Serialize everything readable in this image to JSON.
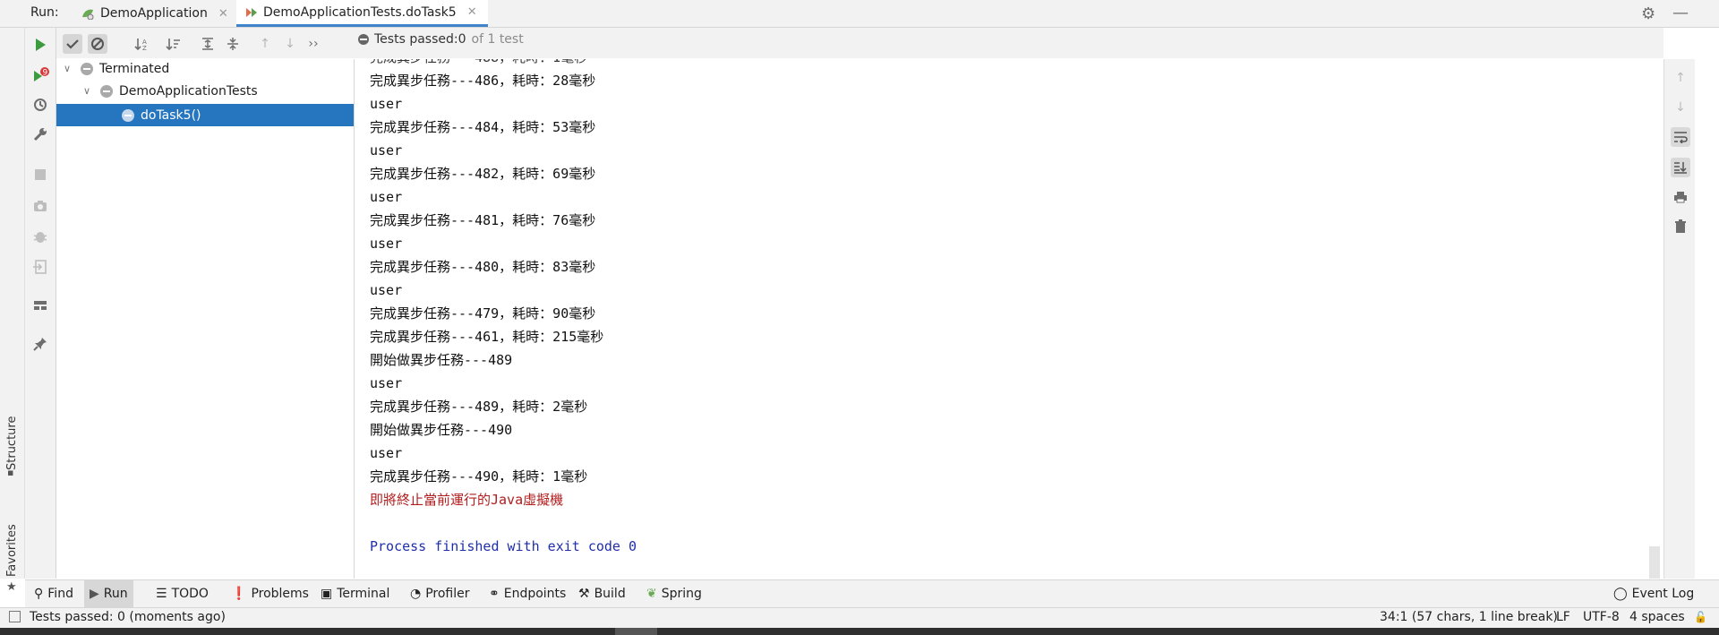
{
  "run_bar": {
    "label": "Run:",
    "tabs": [
      {
        "label": "DemoApplication",
        "active": false
      },
      {
        "label": "DemoApplicationTests.doTask5",
        "active": true
      }
    ]
  },
  "side_strip": {
    "structure_label": "Structure",
    "favorites_label": "Favorites"
  },
  "test_status": {
    "prefix": "Tests passed: ",
    "passed": "0",
    "suffix": "of 1 test"
  },
  "tree": {
    "root": "Terminated",
    "child": "DemoApplicationTests",
    "leaf": "doTask5()"
  },
  "console": {
    "lines": [
      {
        "text": "完成異步任務---486，耗時：28毫秒",
        "kind": "out"
      },
      {
        "text": "user",
        "kind": "out"
      },
      {
        "text": "完成異步任務---484，耗時：53毫秒",
        "kind": "out"
      },
      {
        "text": "user",
        "kind": "out"
      },
      {
        "text": "完成異步任務---482，耗時：69毫秒",
        "kind": "out"
      },
      {
        "text": "user",
        "kind": "out"
      },
      {
        "text": "完成異步任務---481，耗時：76毫秒",
        "kind": "out"
      },
      {
        "text": "user",
        "kind": "out"
      },
      {
        "text": "完成異步任務---480，耗時：83毫秒",
        "kind": "out"
      },
      {
        "text": "user",
        "kind": "out"
      },
      {
        "text": "完成異步任務---479，耗時：90毫秒",
        "kind": "out"
      },
      {
        "text": "完成異步任務---461，耗時：215毫秒",
        "kind": "out"
      },
      {
        "text": "開始做異步任務---489",
        "kind": "out"
      },
      {
        "text": "user",
        "kind": "out"
      },
      {
        "text": "完成異步任務---489，耗時：2毫秒",
        "kind": "out"
      },
      {
        "text": "開始做異步任務---490",
        "kind": "out"
      },
      {
        "text": "user",
        "kind": "out"
      },
      {
        "text": "完成異步任務---490，耗時：1毫秒",
        "kind": "out"
      },
      {
        "text": "即將終止當前運行的Java虛擬機",
        "kind": "err"
      },
      {
        "text": "",
        "kind": "out"
      },
      {
        "text": "Process finished with exit code 0",
        "kind": "sys"
      }
    ]
  },
  "bottom_tabs": {
    "find": "Find",
    "run": "Run",
    "todo": "TODO",
    "problems": "Problems",
    "terminal": "Terminal",
    "profiler": "Profiler",
    "endpoints": "Endpoints",
    "build": "Build",
    "spring": "Spring",
    "event_log": "Event Log"
  },
  "status_bar": {
    "message": "Tests passed: 0 (moments ago)",
    "position": "34:1 (57 chars, 1 line break)",
    "line_sep": "LF",
    "encoding": "UTF-8",
    "indent": "4 spaces"
  },
  "colors": {
    "accent": "#2675bf",
    "run_green": "#3d9b3f",
    "error_text": "#b21d1d",
    "system_text": "#1f2fa8"
  }
}
